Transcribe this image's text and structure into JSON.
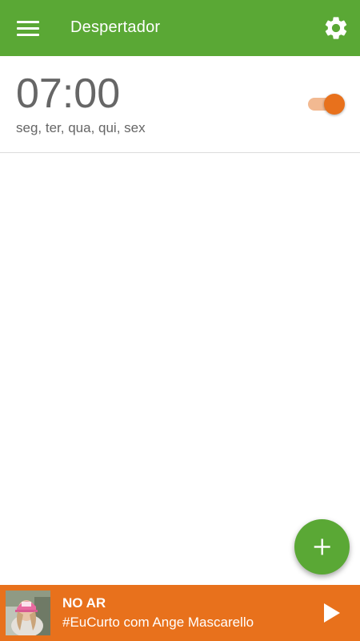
{
  "app_bar": {
    "title": "Despertador",
    "menu_icon": "hamburger-menu-icon",
    "settings_icon": "gear-icon",
    "background_color": "#5aa835"
  },
  "alarms": [
    {
      "time": "07:00",
      "days": "seg, ter, qua, qui, sex",
      "enabled": true
    }
  ],
  "fab": {
    "icon": "plus-icon",
    "color": "#5aa835"
  },
  "player": {
    "status": "NO AR",
    "show": "#EuCurto com Ange Mascarello",
    "play_icon": "play-icon",
    "background_color": "#e8711c"
  },
  "colors": {
    "accent": "#e8711c",
    "toggle_track": "#f2b991",
    "text_secondary": "#666666"
  }
}
